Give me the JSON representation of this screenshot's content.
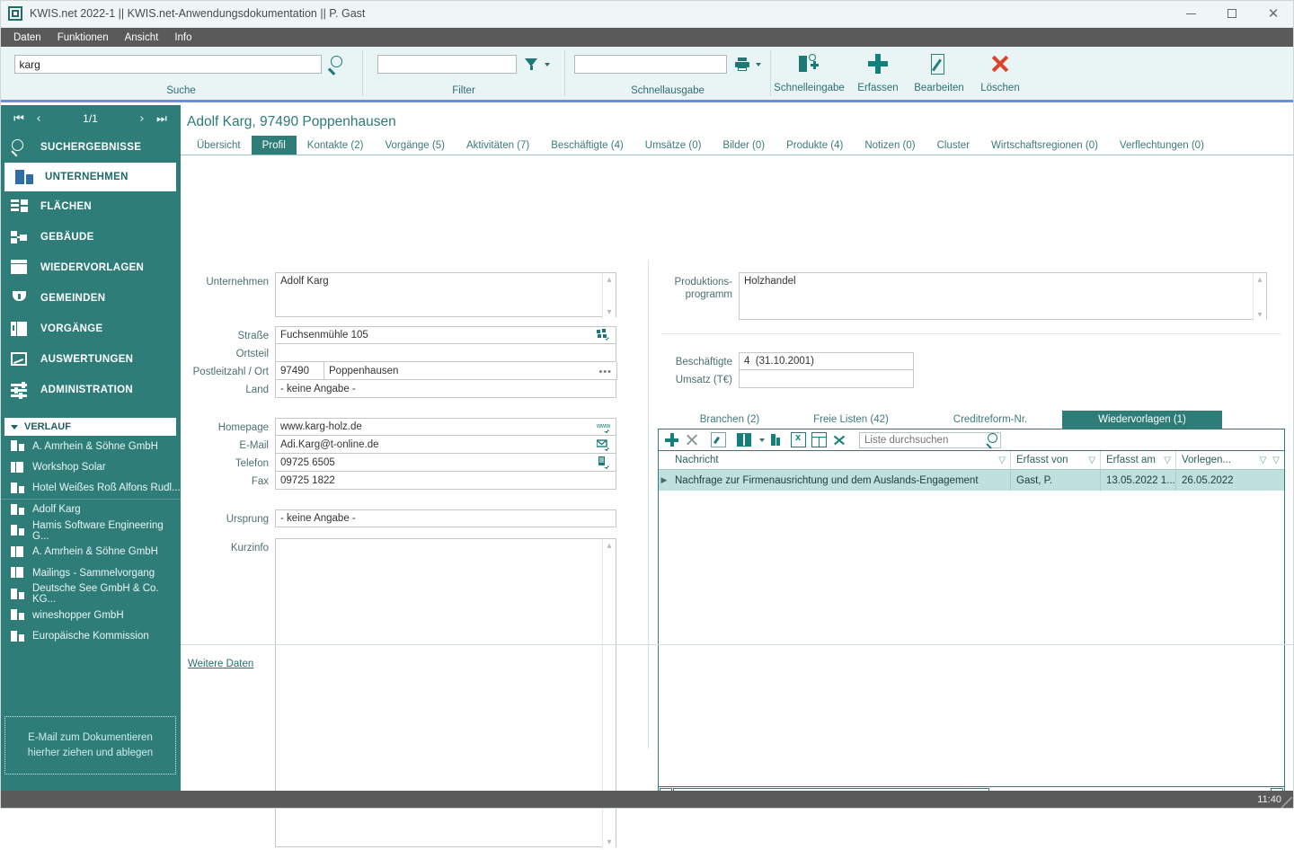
{
  "window": {
    "title": "KWIS.net 2022-1 || KWIS.net-Anwendungsdokumentation || P. Gast",
    "minimize_label": "—",
    "maximize_label": "□",
    "close_label": "✕"
  },
  "menu": {
    "items": [
      "Daten",
      "Funktionen",
      "Ansicht",
      "Info"
    ]
  },
  "ribbon": {
    "search": {
      "value": "karg",
      "label": "Suche",
      "icon": "magnifier-icon"
    },
    "filter": {
      "value": "",
      "label": "Filter",
      "icon": "funnel-icon"
    },
    "quick_output": {
      "value": "",
      "label": "Schnellausgabe",
      "icon": "printer-icon"
    },
    "commands": [
      {
        "label": "Schnelleingabe",
        "icon": "quick-entry-icon"
      },
      {
        "label": "Erfassen",
        "icon": "plus-icon"
      },
      {
        "label": "Bearbeiten",
        "icon": "edit-pencil-icon"
      },
      {
        "label": "Löschen",
        "icon": "delete-x-icon"
      }
    ]
  },
  "sidebar": {
    "pager": {
      "first": "⏮",
      "prev": "‹",
      "position": "1/1",
      "next": "›",
      "last": "⏭"
    },
    "nav": [
      {
        "label": "SUCHERGEBNISSE",
        "icon": "magnifier-icon",
        "active": false
      },
      {
        "label": "UNTERNEHMEN",
        "icon": "company-building-icon",
        "active": true
      },
      {
        "label": "FLÄCHEN",
        "icon": "areas-icon",
        "active": false
      },
      {
        "label": "GEBÄUDE",
        "icon": "buildings-icon",
        "active": false
      },
      {
        "label": "WIEDERVORLAGEN",
        "icon": "calendar-reminder-icon",
        "active": false
      },
      {
        "label": "GEMEINDEN",
        "icon": "shield-icon",
        "active": false
      },
      {
        "label": "VORGÄNGE",
        "icon": "folder-binder-icon",
        "active": false
      },
      {
        "label": "AUSWERTUNGEN",
        "icon": "chart-icon",
        "active": false
      },
      {
        "label": "ADMINISTRATION",
        "icon": "sliders-icon",
        "active": false
      }
    ],
    "history_header": "VERLAUF",
    "history": [
      {
        "label": "A. Amrhein & Söhne GmbH",
        "icon": "company-building-icon"
      },
      {
        "label": "Workshop Solar",
        "icon": "folder-binder-icon"
      },
      {
        "label": "Hotel Weißes Roß Alfons Rudl...",
        "icon": "company-building-icon"
      },
      {
        "label": "Adolf Karg",
        "icon": "company-building-icon"
      },
      {
        "label": "Hamis Software Engineering G...",
        "icon": "company-building-icon"
      },
      {
        "label": "A. Amrhein & Söhne GmbH",
        "icon": "folder-binder-icon"
      },
      {
        "label": "Mailings - Sammelvorgang",
        "icon": "folder-binder-icon"
      },
      {
        "label": "Deutsche See GmbH & Co. KG...",
        "icon": "company-building-icon"
      },
      {
        "label": "wineshopper GmbH",
        "icon": "company-building-icon"
      },
      {
        "label": "Europäische Kommission",
        "icon": "company-building-icon"
      }
    ],
    "drop_area": {
      "line1": "E-Mail  zum Dokumentieren",
      "line2": "hierher ziehen und ablegen"
    }
  },
  "main": {
    "page_title": "Adolf Karg, 97490 Poppenhausen",
    "tabs": [
      {
        "label": "Übersicht",
        "active": false
      },
      {
        "label": "Profil",
        "active": true
      },
      {
        "label": "Kontakte (2)",
        "active": false
      },
      {
        "label": "Vorgänge (5)",
        "active": false
      },
      {
        "label": "Aktivitäten (7)",
        "active": false
      },
      {
        "label": "Beschäftigte (4)",
        "active": false
      },
      {
        "label": "Umsätze (0)",
        "active": false
      },
      {
        "label": "Bilder (0)",
        "active": false
      },
      {
        "label": "Produkte (4)",
        "active": false
      },
      {
        "label": "Notizen (0)",
        "active": false
      },
      {
        "label": "Cluster",
        "active": false
      },
      {
        "label": "Wirtschaftsregionen (0)",
        "active": false
      },
      {
        "label": "Verflechtungen (0)",
        "active": false
      }
    ],
    "form": {
      "unternehmen": {
        "label": "Unternehmen",
        "value": "Adolf Karg"
      },
      "strasse": {
        "label": "Straße",
        "value": "Fuchsenmühle 105",
        "icon": "map-street-icon"
      },
      "ortsteil": {
        "label": "Ortsteil",
        "value": ""
      },
      "plz_ort": {
        "label": "Postleitzahl / Ort",
        "plz": "97490",
        "ort": "Poppenhausen",
        "more": "•••"
      },
      "land": {
        "label": "Land",
        "value": "- keine Angabe -"
      },
      "homepage": {
        "label": "Homepage",
        "value": "www.karg-holz.de",
        "icon": "www-link-icon"
      },
      "email": {
        "label": "E-Mail",
        "value": "Adi.Karg@t-online.de",
        "icon": "mail-send-icon"
      },
      "telefon": {
        "label": "Telefon",
        "value": "09725 6505",
        "icon": "phone-dial-icon"
      },
      "fax": {
        "label": "Fax",
        "value": "09725 1822"
      },
      "ursprung": {
        "label": "Ursprung",
        "value": "- keine Angabe -"
      },
      "kurzinfo": {
        "label": "Kurzinfo",
        "value": ""
      }
    },
    "right": {
      "produktionsprogramm": {
        "label_line1": "Produktions-",
        "label_line2": "programm",
        "value": "Holzhandel"
      },
      "beschaeftigte": {
        "label": "Beschäftigte",
        "value": "4  (31.10.2001)"
      },
      "umsatz": {
        "label": "Umsatz (T€)",
        "value": ""
      },
      "inner_tabs": [
        {
          "label": "Branchen (2)",
          "active": false
        },
        {
          "label": "Freie Listen (42)",
          "active": false
        },
        {
          "label": "Creditreform-Nr.",
          "active": false
        },
        {
          "label": "Wiedervorlagen (1)",
          "active": true
        }
      ],
      "grid_toolbar": {
        "search_placeholder": "Liste durchsuchen",
        "search_value": "",
        "icons": [
          "add-plus-icon",
          "delete-x-icon",
          "edit-note-icon",
          "column-chooser-icon",
          "chevron-down-icon",
          "clear-filter-icon",
          "export-excel-icon",
          "grid-layout-icon",
          "expand-arrows-icon",
          "magnifier-icon"
        ]
      },
      "grid": {
        "columns": [
          {
            "label": "Nachricht",
            "filter_icon": "filter-icon"
          },
          {
            "label": "Erfasst von",
            "filter_icon": "filter-icon"
          },
          {
            "label": "Erfasst am",
            "filter_icon": "filter-icon"
          },
          {
            "label": "Vorlegen...",
            "filter_icon": "filter-icon",
            "sort_icon": "sort-desc-icon"
          }
        ],
        "rows": [
          {
            "selected": true,
            "nachricht": "Nachfrage zur Firmenausrichtung und dem Auslands-Engagement",
            "erfasst_von": "Gast, P.",
            "erfasst_am": "13.05.2022  1...",
            "vorlegen": "26.05.2022"
          }
        ]
      },
      "hscroll": {
        "left_arrow": "◀",
        "right_arrow": "▶"
      }
    },
    "further_data_link": "Weitere Daten"
  },
  "status": {
    "time": "11:40"
  },
  "colors": {
    "teal": "#2e7d78",
    "teal_dark": "#1b6e6a",
    "ribbon_bg": "#e9f4f4",
    "accent_blue": "#6f8ed8",
    "menu_gray": "#5a5a5a",
    "row_select": "#bfe0dd",
    "delete_red": "#d8452b"
  }
}
